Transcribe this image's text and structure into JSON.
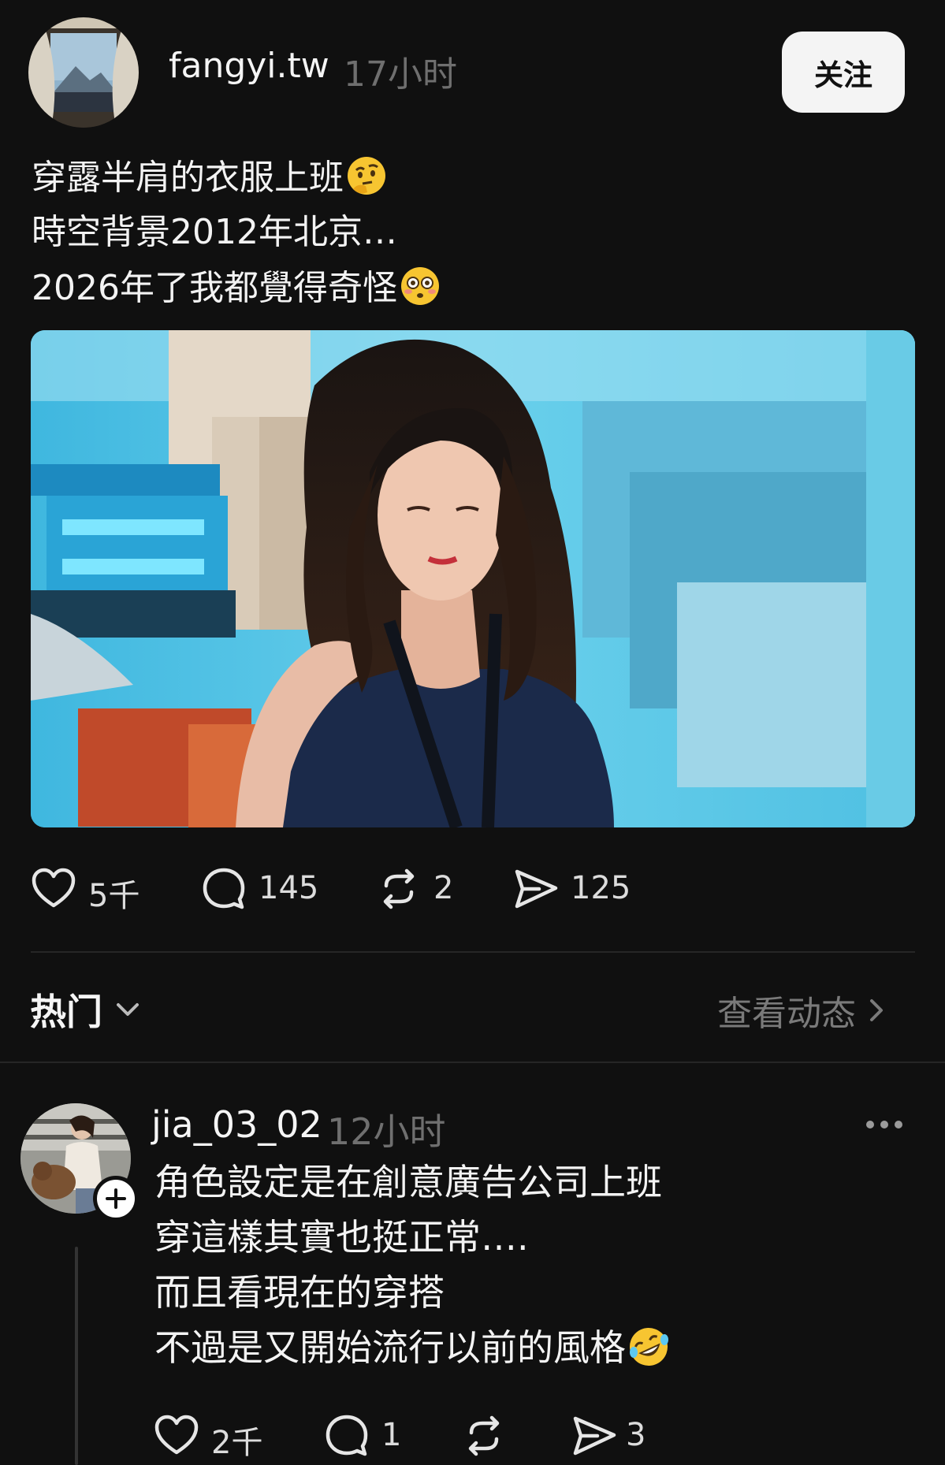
{
  "post": {
    "username": "fangyi.tw",
    "time": "17小时",
    "follow_label": "关注",
    "lines": [
      "穿露半肩的衣服上班",
      "時空背景2012年北京…",
      "2026年了我都覺得奇怪"
    ],
    "emojis": [
      "thinking-face",
      "flushed-face"
    ],
    "stats": {
      "likes": "5千",
      "comments": "145",
      "reposts": "2",
      "shares": "125"
    }
  },
  "section": {
    "title": "热门",
    "view_activity": "查看动态"
  },
  "reply": {
    "username": "jia_03_02",
    "time": "12小时",
    "lines": [
      "角色設定是在創意廣告公司上班",
      "穿這樣其實也挺正常….",
      "而且看現在的穿搭",
      "不過是又開始流行以前的風格"
    ],
    "emoji": "rolling-on-floor-laughing",
    "stats": {
      "likes": "2千",
      "comments": "1",
      "reposts": "",
      "shares": "3"
    }
  },
  "colors": {
    "background": "#101010",
    "text": "#f3f3f3",
    "muted": "#6f6f6f",
    "follow_bg": "#f4f4f4"
  }
}
